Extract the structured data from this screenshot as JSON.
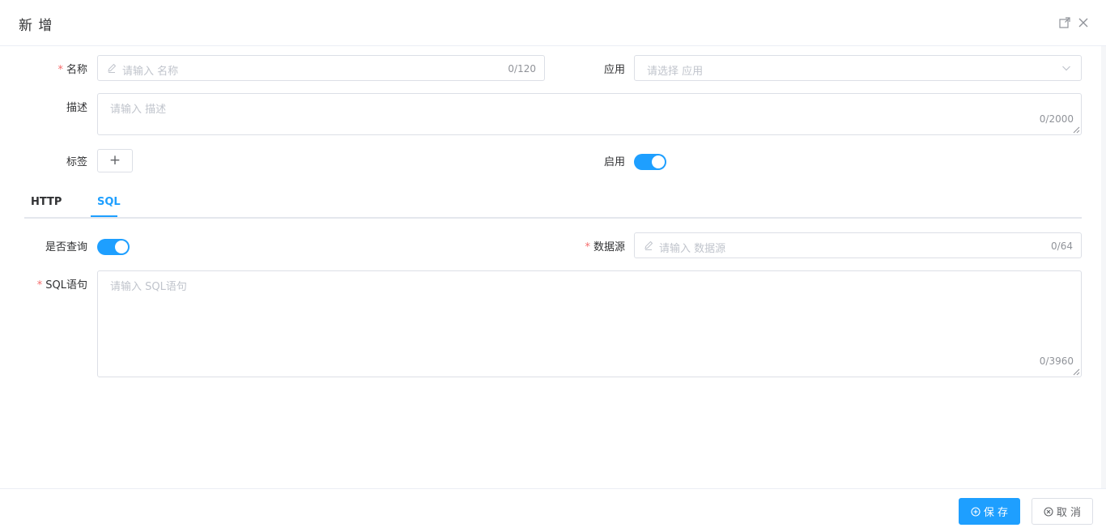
{
  "dialog": {
    "title": "新 增"
  },
  "form": {
    "name": {
      "required_mark": "*",
      "label": "名称",
      "placeholder": "请输入 名称",
      "count": "0/120"
    },
    "application": {
      "label": "应用",
      "placeholder": "请选择 应用"
    },
    "description": {
      "label": "描述",
      "placeholder": "请输入 描述",
      "count": "0/2000"
    },
    "tags": {
      "label": "标签",
      "add_label": "+"
    },
    "enabled": {
      "label": "启用",
      "value": true
    }
  },
  "tabs": [
    {
      "label": "HTTP",
      "active": false
    },
    {
      "label": "SQL",
      "active": true
    }
  ],
  "sql": {
    "is_query": {
      "label": "是否查询",
      "value": true
    },
    "datasource": {
      "required_mark": "*",
      "label": "数据源",
      "placeholder": "请输入 数据源",
      "count": "0/64"
    },
    "statement": {
      "required_mark": "*",
      "label": "SQL语句",
      "placeholder": "请输入 SQL语句",
      "count": "0/3960"
    }
  },
  "footer": {
    "save_label": "保 存",
    "cancel_label": "取 消"
  },
  "colors": {
    "accent": "#1e9fff",
    "required": "#f56c6c",
    "border": "#dcdfe6",
    "placeholder": "#c0c4cc"
  }
}
